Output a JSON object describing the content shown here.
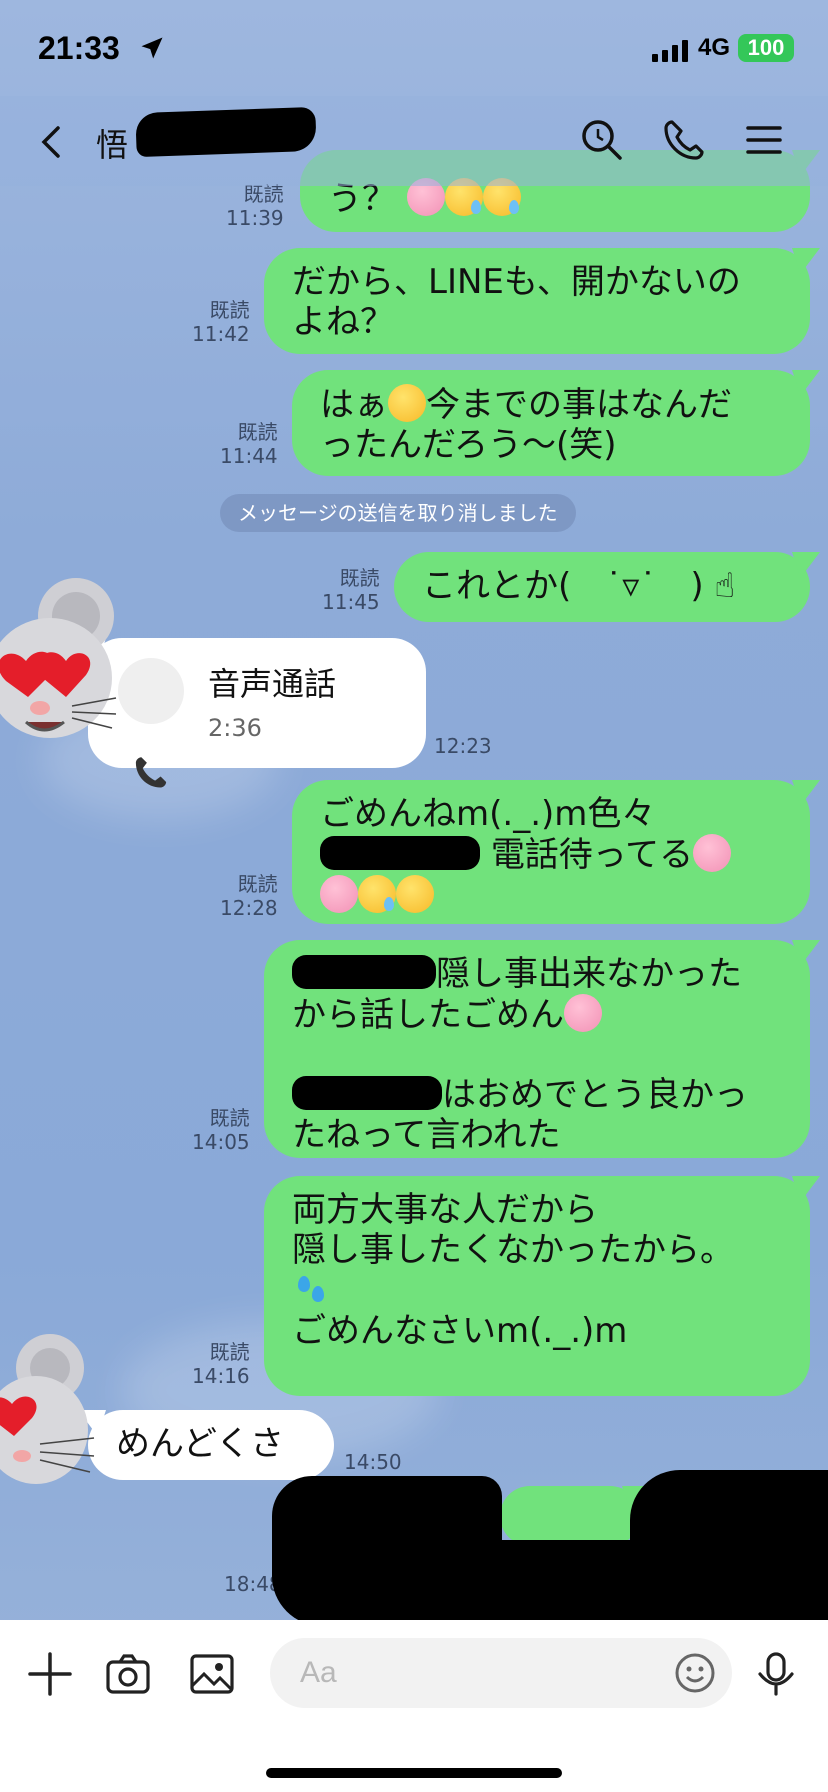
{
  "status_bar": {
    "time": "21:33",
    "network": "4G",
    "battery": "100"
  },
  "header": {
    "contact_name": "悟"
  },
  "messages": [
    {
      "read": "既読",
      "time": "11:39",
      "text": "う？"
    },
    {
      "read": "既読",
      "time": "11:42",
      "text": "だから、LINEも、開かないの\nよね？"
    },
    {
      "read": "既読",
      "time": "11:44",
      "text_1": "はぁ",
      "text_2": "今までの事はなんだ\nったんだろう〜(笑)"
    },
    {
      "read": "既読",
      "time": "11:45",
      "text": "これとか(　˙▿˙　)"
    },
    {
      "read": "既読",
      "time": "12:28",
      "text_1": "ごめんねm(._.)m色々",
      "text_2": "電話待ってる"
    },
    {
      "read": "既読",
      "time": "14:05",
      "text_1": "隠し事出来なかった\nから話したごめん",
      "text_2": "はおめでとう良かっ\nたねって言われた"
    },
    {
      "read": "既読",
      "time": "14:16",
      "text_1": "両方大事な人だから\n隠し事したくなかったから。",
      "text_2": "ごめんなさいm(._.)m"
    }
  ],
  "system_message": "メッセージの送信を取り消しました",
  "call": {
    "label": "音声通話",
    "duration": "2:36",
    "time": "12:23"
  },
  "incoming": {
    "text": "めんどくさ",
    "time": "14:50"
  },
  "bottom_time": "18:48",
  "input": {
    "placeholder": "Aa"
  }
}
